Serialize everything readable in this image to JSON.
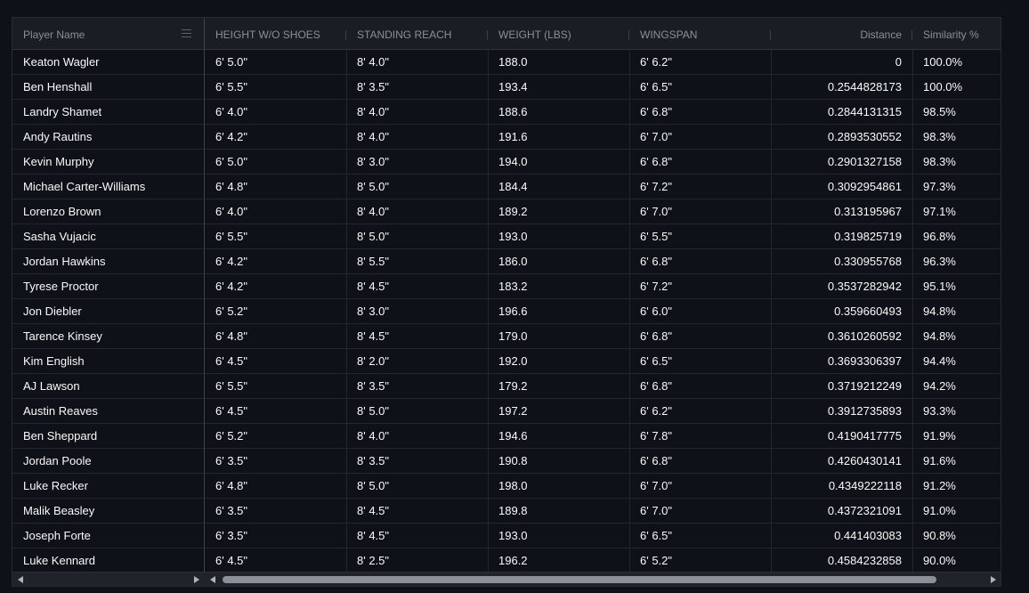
{
  "columns": {
    "player_name": "Player Name",
    "height": "HEIGHT W/O SHOES",
    "reach": "STANDING REACH",
    "weight": "WEIGHT (LBS)",
    "wingspan": "WINGSPAN",
    "distance": "Distance",
    "similarity": "Similarity %"
  },
  "rows": [
    {
      "name": "Keaton Wagler",
      "height": "6' 5.0\"",
      "reach": "8' 4.0\"",
      "weight": "188.0",
      "wingspan": "6' 6.2\"",
      "distance": "0",
      "similarity": "100.0%"
    },
    {
      "name": "Ben Henshall",
      "height": "6' 5.5\"",
      "reach": "8' 3.5\"",
      "weight": "193.4",
      "wingspan": "6' 6.5\"",
      "distance": "0.2544828173",
      "similarity": "100.0%"
    },
    {
      "name": "Landry Shamet",
      "height": "6' 4.0\"",
      "reach": "8' 4.0\"",
      "weight": "188.6",
      "wingspan": "6' 6.8\"",
      "distance": "0.2844131315",
      "similarity": "98.5%"
    },
    {
      "name": "Andy Rautins",
      "height": "6' 4.2\"",
      "reach": "8' 4.0\"",
      "weight": "191.6",
      "wingspan": "6' 7.0\"",
      "distance": "0.2893530552",
      "similarity": "98.3%"
    },
    {
      "name": "Kevin Murphy",
      "height": "6' 5.0\"",
      "reach": "8' 3.0\"",
      "weight": "194.0",
      "wingspan": "6' 6.8\"",
      "distance": "0.2901327158",
      "similarity": "98.3%"
    },
    {
      "name": "Michael Carter-Williams",
      "height": "6' 4.8\"",
      "reach": "8' 5.0\"",
      "weight": "184.4",
      "wingspan": "6' 7.2\"",
      "distance": "0.3092954861",
      "similarity": "97.3%"
    },
    {
      "name": "Lorenzo Brown",
      "height": "6' 4.0\"",
      "reach": "8' 4.0\"",
      "weight": "189.2",
      "wingspan": "6' 7.0\"",
      "distance": "0.313195967",
      "similarity": "97.1%"
    },
    {
      "name": "Sasha Vujacic",
      "height": "6' 5.5\"",
      "reach": "8' 5.0\"",
      "weight": "193.0",
      "wingspan": "6' 5.5\"",
      "distance": "0.319825719",
      "similarity": "96.8%"
    },
    {
      "name": "Jordan Hawkins",
      "height": "6' 4.2\"",
      "reach": "8' 5.5\"",
      "weight": "186.0",
      "wingspan": "6' 6.8\"",
      "distance": "0.330955768",
      "similarity": "96.3%"
    },
    {
      "name": "Tyrese Proctor",
      "height": "6' 4.2\"",
      "reach": "8' 4.5\"",
      "weight": "183.2",
      "wingspan": "6' 7.2\"",
      "distance": "0.3537282942",
      "similarity": "95.1%"
    },
    {
      "name": "Jon Diebler",
      "height": "6' 5.2\"",
      "reach": "8' 3.0\"",
      "weight": "196.6",
      "wingspan": "6' 6.0\"",
      "distance": "0.359660493",
      "similarity": "94.8%"
    },
    {
      "name": "Tarence Kinsey",
      "height": "6' 4.8\"",
      "reach": "8' 4.5\"",
      "weight": "179.0",
      "wingspan": "6' 6.8\"",
      "distance": "0.3610260592",
      "similarity": "94.8%"
    },
    {
      "name": "Kim English",
      "height": "6' 4.5\"",
      "reach": "8' 2.0\"",
      "weight": "192.0",
      "wingspan": "6' 6.5\"",
      "distance": "0.3693306397",
      "similarity": "94.4%"
    },
    {
      "name": "AJ Lawson",
      "height": "6' 5.5\"",
      "reach": "8' 3.5\"",
      "weight": "179.2",
      "wingspan": "6' 6.8\"",
      "distance": "0.3719212249",
      "similarity": "94.2%"
    },
    {
      "name": "Austin Reaves",
      "height": "6' 4.5\"",
      "reach": "8' 5.0\"",
      "weight": "197.2",
      "wingspan": "6' 6.2\"",
      "distance": "0.3912735893",
      "similarity": "93.3%"
    },
    {
      "name": "Ben Sheppard",
      "height": "6' 5.2\"",
      "reach": "8' 4.0\"",
      "weight": "194.6",
      "wingspan": "6' 7.8\"",
      "distance": "0.4190417775",
      "similarity": "91.9%"
    },
    {
      "name": "Jordan Poole",
      "height": "6' 3.5\"",
      "reach": "8' 3.5\"",
      "weight": "190.8",
      "wingspan": "6' 6.8\"",
      "distance": "0.4260430141",
      "similarity": "91.6%"
    },
    {
      "name": "Luke Recker",
      "height": "6' 4.8\"",
      "reach": "8' 5.0\"",
      "weight": "198.0",
      "wingspan": "6' 7.0\"",
      "distance": "0.4349222118",
      "similarity": "91.2%"
    },
    {
      "name": "Malik Beasley",
      "height": "6' 3.5\"",
      "reach": "8' 4.5\"",
      "weight": "189.8",
      "wingspan": "6' 7.0\"",
      "distance": "0.4372321091",
      "similarity": "91.0%"
    },
    {
      "name": "Joseph Forte",
      "height": "6' 3.5\"",
      "reach": "8' 4.5\"",
      "weight": "193.0",
      "wingspan": "6' 6.5\"",
      "distance": "0.441403083",
      "similarity": "90.8%"
    },
    {
      "name": "Luke Kennard",
      "height": "6' 4.5\"",
      "reach": "8' 2.5\"",
      "weight": "196.2",
      "wingspan": "6' 5.2\"",
      "distance": "0.4584232858",
      "similarity": "90.0%"
    }
  ],
  "icons": {
    "column_menu": "menu-icon",
    "scroll_left": "arrow-left-icon",
    "scroll_right": "arrow-right-icon"
  },
  "colors": {
    "background": "#0e1117",
    "header_bg": "#1a1d24",
    "text": "#fafafa",
    "header_text": "#8b8f98"
  }
}
